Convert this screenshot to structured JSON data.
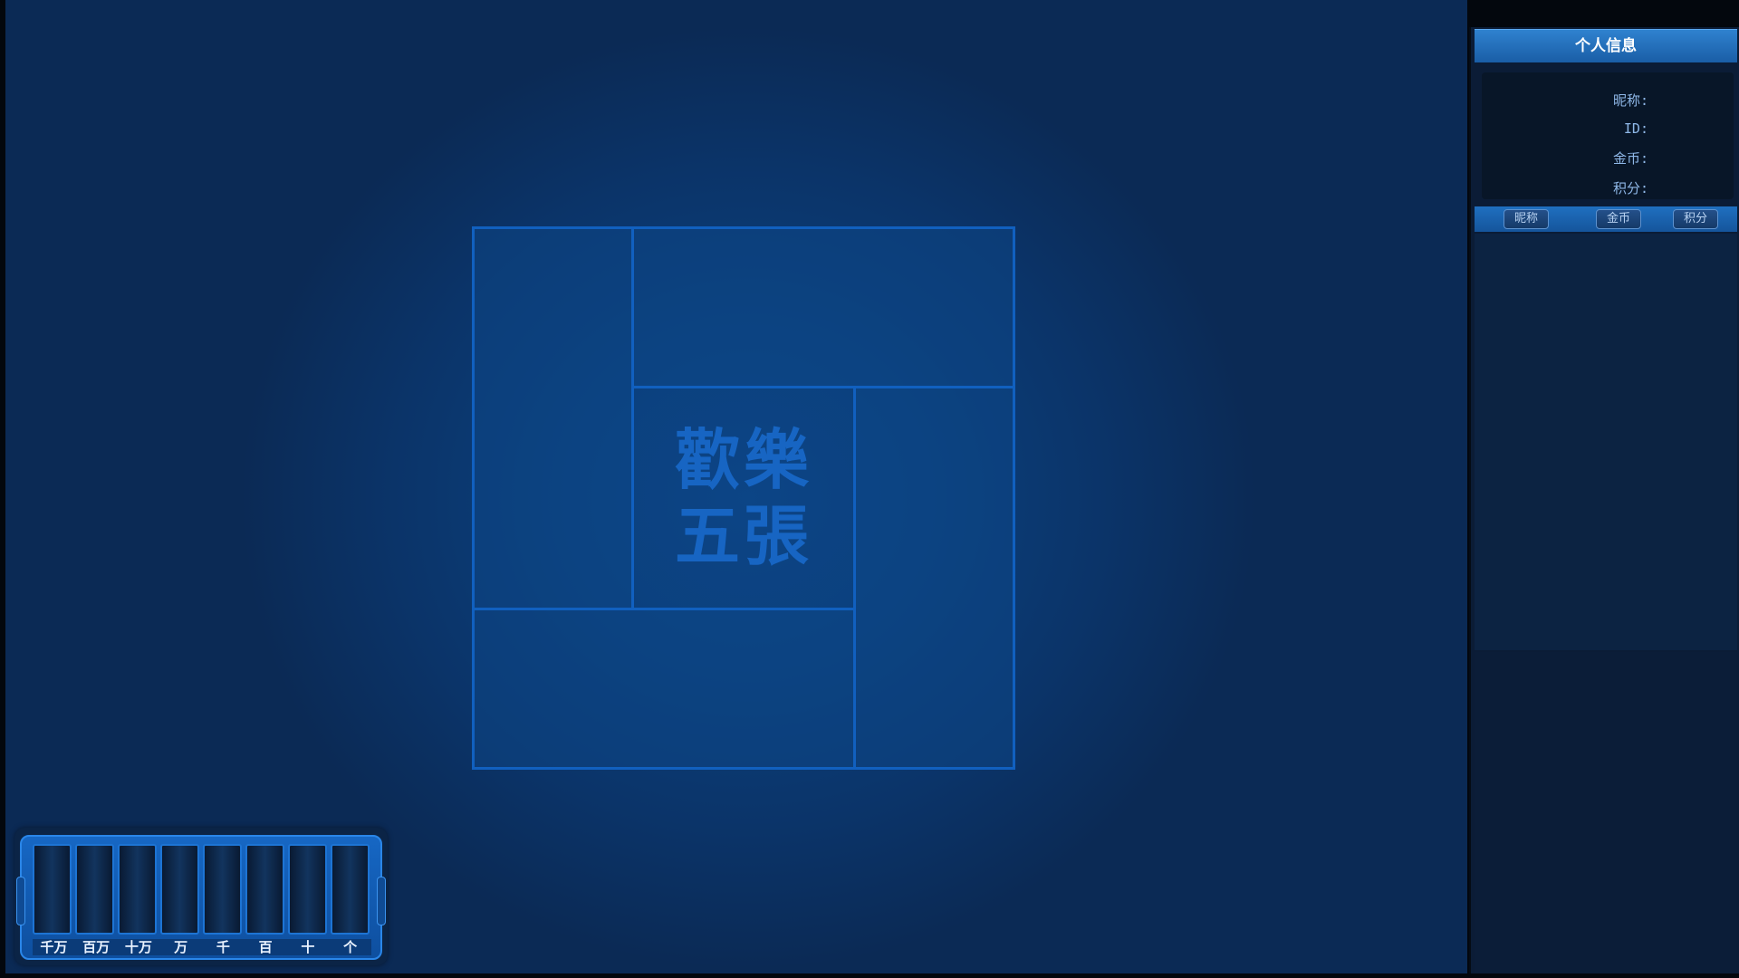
{
  "board": {
    "logo_line1": "歡樂",
    "logo_line2": "五張"
  },
  "bet_counter": {
    "digit_labels": [
      "千万",
      "百万",
      "十万",
      "万",
      "千",
      "百",
      "十",
      "个"
    ]
  },
  "info_panel": {
    "title": "个人信息",
    "fields": {
      "nickname": "昵称:",
      "id": "ID:",
      "gold": "金币:",
      "score": "积分:"
    },
    "tabs": {
      "nickname": "昵称",
      "gold": "金币",
      "score": "积分"
    }
  },
  "colors": {
    "accent": "#1160bf",
    "logo": "#1765c3",
    "panel_header": "#2f82cf"
  }
}
